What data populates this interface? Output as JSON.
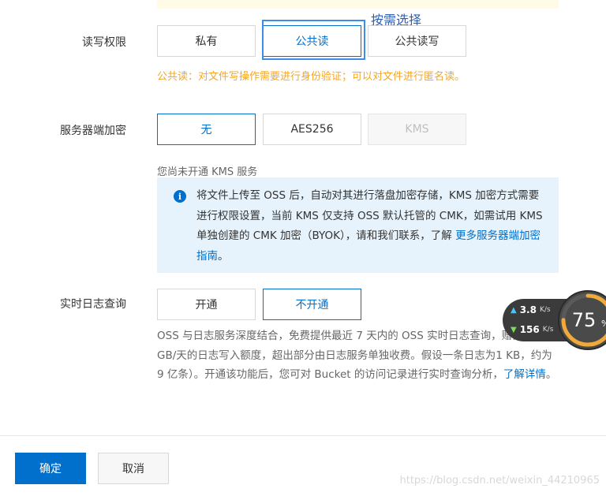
{
  "annotation": {
    "text": "按需选择"
  },
  "acl": {
    "label": "读写权限",
    "options": [
      "私有",
      "公共读",
      "公共读写"
    ],
    "selected": "公共读",
    "hint": "公共读：对文件写操作需要进行身份验证；可以对文件进行匿名读。"
  },
  "encryption": {
    "label": "服务器端加密",
    "options": [
      "无",
      "AES256",
      "KMS"
    ],
    "selected": "无",
    "disabled": [
      "KMS"
    ],
    "kms_hint": "您尚未开通 KMS 服务",
    "info": {
      "text": "将文件上传至 OSS 后，自动对其进行落盘加密存储，KMS 加密方式需要进行权限设置，当前 KMS 仅支持 OSS 默认托管的 CMK，如需试用 KMS 单独创建的 CMK 加密（BYOK），请和我们联系，了解 ",
      "link": "更多服务器端加密指南",
      "suffix": "。"
    }
  },
  "logging": {
    "label": "实时日志查询",
    "options": [
      "开通",
      "不开通"
    ],
    "selected": "不开通",
    "desc": "OSS 与日志服务深度结合，免费提供最近 7 天内的 OSS 实时日志查询，赠额 900 GB/天的日志写入额度，超出部分由日志服务单独收费。假设一条日志为1 KB，约为 9 亿条）。开通该功能后，您可对 Bucket 的访问记录进行实时查询分析，",
    "link": "了解详情",
    "suffix": "。"
  },
  "footer": {
    "confirm": "确定",
    "cancel": "取消"
  },
  "net_widget": {
    "up_value": "3.8",
    "up_unit": "K/s",
    "down_value": "156",
    "down_unit": "K/s",
    "percent": "75",
    "percent_unit": "%"
  },
  "watermark": "https://blog.csdn.net/weixin_44210965",
  "colors": {
    "primary": "#0070cc",
    "warning": "#f5a623",
    "info_bg": "#e6f3fc"
  }
}
